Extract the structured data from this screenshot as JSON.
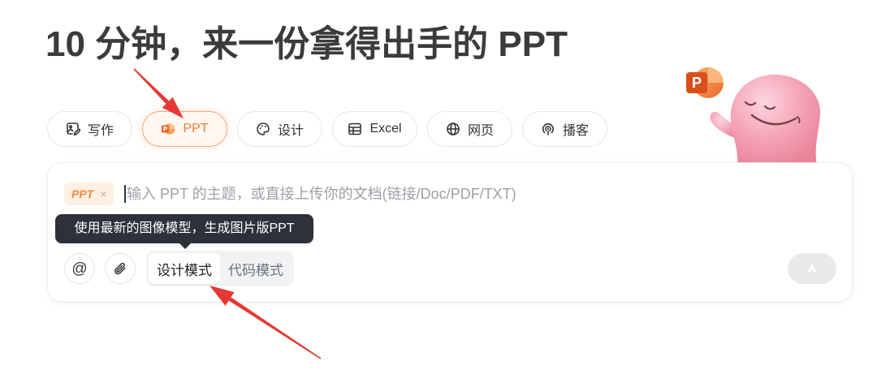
{
  "header": {
    "title": "10 分钟，来一份拿得出手的 PPT"
  },
  "tabs": [
    {
      "label": "写作",
      "icon": "image-edit-icon",
      "selected": false
    },
    {
      "label": "PPT",
      "icon": "ppt-icon",
      "selected": true
    },
    {
      "label": "设计",
      "icon": "palette-icon",
      "selected": false
    },
    {
      "label": "Excel",
      "icon": "table-icon",
      "selected": false
    },
    {
      "label": "网页",
      "icon": "globe-icon",
      "selected": false
    },
    {
      "label": "播客",
      "icon": "podcast-icon",
      "selected": false
    }
  ],
  "mascot": {
    "badge_letter": "P"
  },
  "composer": {
    "tag": {
      "label": "PPT",
      "remove": "×"
    },
    "input": {
      "value": "",
      "placeholder": "输入 PPT 的主题，或直接上传你的文档(链接/Doc/PDF/TXT)"
    },
    "tooltip": "使用最新的图像模型，生成图片版PPT",
    "mention": {
      "label": "@",
      "icon": "at-icon"
    },
    "attach": {
      "icon": "paperclip-icon"
    },
    "modes": [
      {
        "label": "设计模式",
        "selected": true
      },
      {
        "label": "代码模式",
        "selected": false
      }
    ],
    "send": {
      "icon": "send-arrow-icon",
      "enabled": false
    }
  },
  "colors": {
    "accent": "#ef7b32",
    "annotation": "#e53935",
    "tooltip_bg": "#2d3139",
    "mascot": "#f4a3b5"
  }
}
